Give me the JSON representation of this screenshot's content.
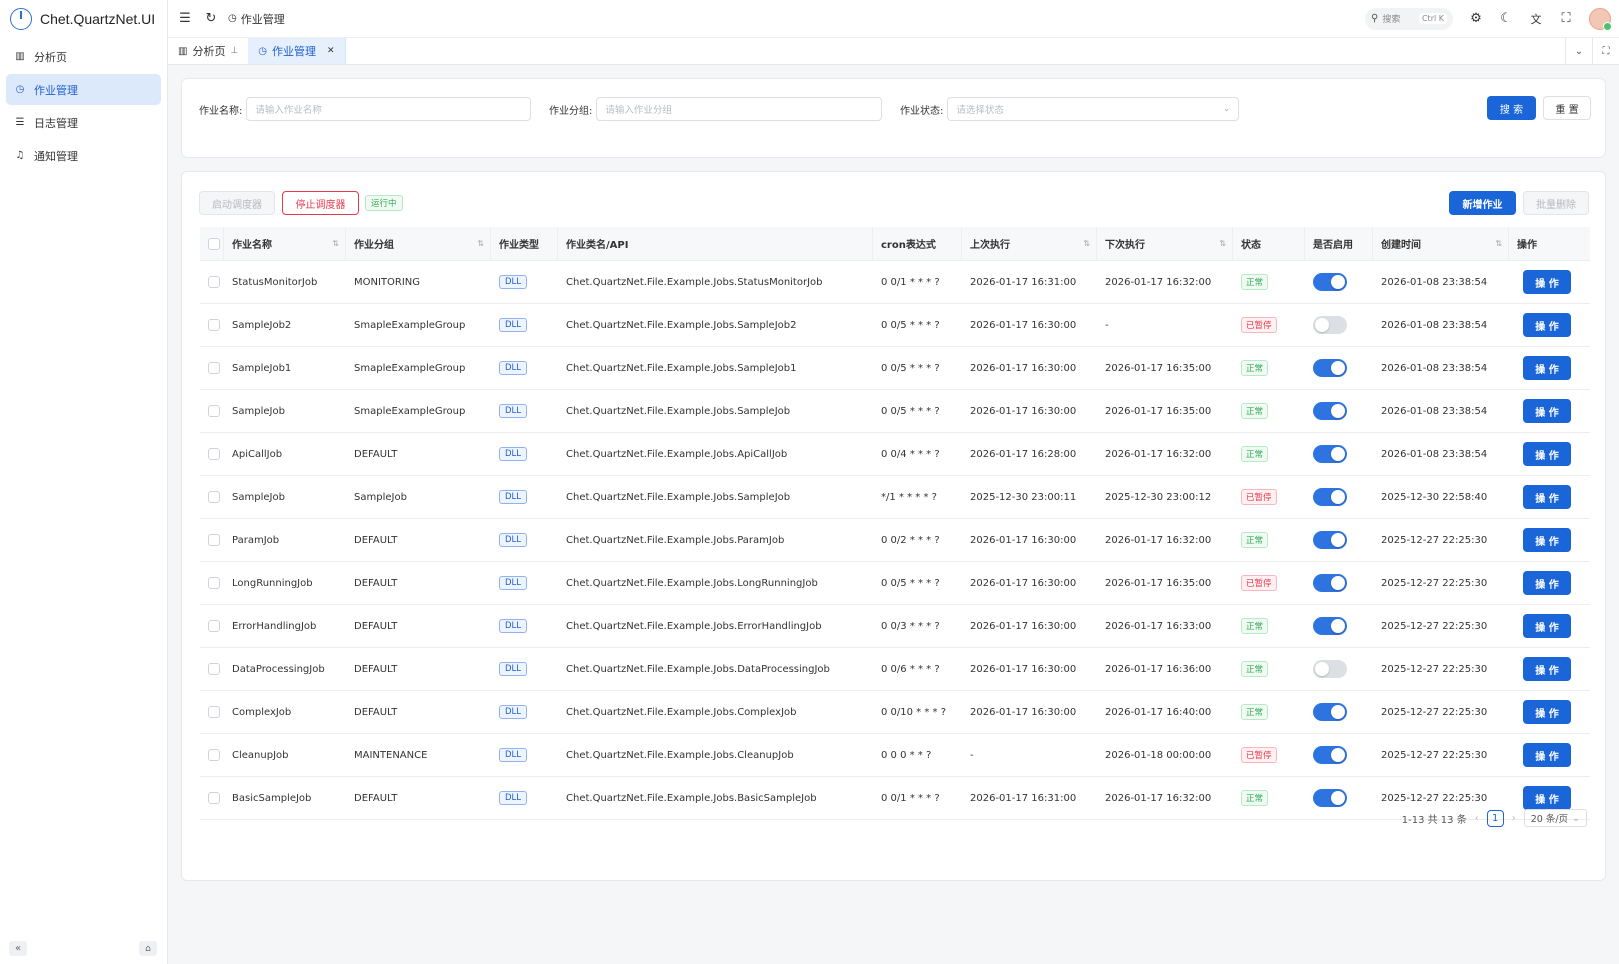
{
  "app": {
    "title": "Chet.QuartzNet.UI"
  },
  "sidebar": {
    "items": [
      {
        "label": "分析页",
        "icon": "chart-icon",
        "active": false
      },
      {
        "label": "作业管理",
        "icon": "clock-icon",
        "active": true
      },
      {
        "label": "日志管理",
        "icon": "list-icon",
        "active": false
      },
      {
        "label": "通知管理",
        "icon": "bell-icon",
        "active": false
      }
    ],
    "collapse_glyph": "«",
    "pin_glyph": "⌂"
  },
  "header": {
    "breadcrumb": "作业管理",
    "search_placeholder": "搜索",
    "search_shortcut": "Ctrl K"
  },
  "tabs": [
    {
      "label": "分析页",
      "active": false
    },
    {
      "label": "作业管理",
      "active": true
    }
  ],
  "filters": {
    "job_name": {
      "label": "作业名称:",
      "placeholder": "请输入作业名称"
    },
    "job_group": {
      "label": "作业分组:",
      "placeholder": "请输入作业分组"
    },
    "job_status": {
      "label": "作业状态:",
      "placeholder": "请选择状态"
    },
    "search_button": "搜 索",
    "reset_button": "重 置"
  },
  "toolbar": {
    "start_scheduler": "启动调度器",
    "stop_scheduler": "停止调度器",
    "scheduler_status": "运行中",
    "add_job": "新增作业",
    "batch_delete": "批量删除"
  },
  "table": {
    "columns": [
      "作业名称",
      "作业分组",
      "作业类型",
      "作业类名/API",
      "cron表达式",
      "上次执行",
      "下次执行",
      "状态",
      "是否启用",
      "创建时间",
      "操作"
    ],
    "op_label": "操 作",
    "rows": [
      {
        "name": "StatusMonitorJob",
        "group": "MONITORING",
        "type": "DLL",
        "class": "Chet.QuartzNet.File.Example.Jobs.StatusMonitorJob",
        "cron": "0 0/1 * * * ?",
        "last": "2026-01-17 16:31:00",
        "next": "2026-01-17 16:32:00",
        "status": "正常",
        "enabled": true,
        "created": "2026-01-08 23:38:54"
      },
      {
        "name": "SampleJob2",
        "group": "SmapleExampleGroup",
        "type": "DLL",
        "class": "Chet.QuartzNet.File.Example.Jobs.SampleJob2",
        "cron": "0 0/5 * * * ?",
        "last": "2026-01-17 16:30:00",
        "next": "-",
        "status": "已暂停",
        "enabled": false,
        "created": "2026-01-08 23:38:54"
      },
      {
        "name": "SampleJob1",
        "group": "SmapleExampleGroup",
        "type": "DLL",
        "class": "Chet.QuartzNet.File.Example.Jobs.SampleJob1",
        "cron": "0 0/5 * * * ?",
        "last": "2026-01-17 16:30:00",
        "next": "2026-01-17 16:35:00",
        "status": "正常",
        "enabled": true,
        "created": "2026-01-08 23:38:54"
      },
      {
        "name": "SampleJob",
        "group": "SmapleExampleGroup",
        "type": "DLL",
        "class": "Chet.QuartzNet.File.Example.Jobs.SampleJob",
        "cron": "0 0/5 * * * ?",
        "last": "2026-01-17 16:30:00",
        "next": "2026-01-17 16:35:00",
        "status": "正常",
        "enabled": true,
        "created": "2026-01-08 23:38:54"
      },
      {
        "name": "ApiCallJob",
        "group": "DEFAULT",
        "type": "DLL",
        "class": "Chet.QuartzNet.File.Example.Jobs.ApiCallJob",
        "cron": "0 0/4 * * * ?",
        "last": "2026-01-17 16:28:00",
        "next": "2026-01-17 16:32:00",
        "status": "正常",
        "enabled": true,
        "created": "2026-01-08 23:38:54"
      },
      {
        "name": "SampleJob",
        "group": "SampleJob",
        "type": "DLL",
        "class": "Chet.QuartzNet.File.Example.Jobs.SampleJob",
        "cron": "*/1 * * * * ?",
        "last": "2025-12-30 23:00:11",
        "next": "2025-12-30 23:00:12",
        "status": "已暂停",
        "enabled": true,
        "created": "2025-12-30 22:58:40"
      },
      {
        "name": "ParamJob",
        "group": "DEFAULT",
        "type": "DLL",
        "class": "Chet.QuartzNet.File.Example.Jobs.ParamJob",
        "cron": "0 0/2 * * * ?",
        "last": "2026-01-17 16:30:00",
        "next": "2026-01-17 16:32:00",
        "status": "正常",
        "enabled": true,
        "created": "2025-12-27 22:25:30"
      },
      {
        "name": "LongRunningJob",
        "group": "DEFAULT",
        "type": "DLL",
        "class": "Chet.QuartzNet.File.Example.Jobs.LongRunningJob",
        "cron": "0 0/5 * * * ?",
        "last": "2026-01-17 16:30:00",
        "next": "2026-01-17 16:35:00",
        "status": "已暂停",
        "enabled": true,
        "created": "2025-12-27 22:25:30"
      },
      {
        "name": "ErrorHandlingJob",
        "group": "DEFAULT",
        "type": "DLL",
        "class": "Chet.QuartzNet.File.Example.Jobs.ErrorHandlingJob",
        "cron": "0 0/3 * * * ?",
        "last": "2026-01-17 16:30:00",
        "next": "2026-01-17 16:33:00",
        "status": "正常",
        "enabled": true,
        "created": "2025-12-27 22:25:30"
      },
      {
        "name": "DataProcessingJob",
        "group": "DEFAULT",
        "type": "DLL",
        "class": "Chet.QuartzNet.File.Example.Jobs.DataProcessingJob",
        "cron": "0 0/6 * * * ?",
        "last": "2026-01-17 16:30:00",
        "next": "2026-01-17 16:36:00",
        "status": "正常",
        "enabled": false,
        "created": "2025-12-27 22:25:30"
      },
      {
        "name": "ComplexJob",
        "group": "DEFAULT",
        "type": "DLL",
        "class": "Chet.QuartzNet.File.Example.Jobs.ComplexJob",
        "cron": "0 0/10 * * * ?",
        "last": "2026-01-17 16:30:00",
        "next": "2026-01-17 16:40:00",
        "status": "正常",
        "enabled": true,
        "created": "2025-12-27 22:25:30"
      },
      {
        "name": "CleanupJob",
        "group": "MAINTENANCE",
        "type": "DLL",
        "class": "Chet.QuartzNet.File.Example.Jobs.CleanupJob",
        "cron": "0 0 0 * * ?",
        "last": "-",
        "next": "2026-01-18 00:00:00",
        "status": "已暂停",
        "enabled": true,
        "created": "2025-12-27 22:25:30"
      },
      {
        "name": "BasicSampleJob",
        "group": "DEFAULT",
        "type": "DLL",
        "class": "Chet.QuartzNet.File.Example.Jobs.BasicSampleJob",
        "cron": "0 0/1 * * * ?",
        "last": "2026-01-17 16:31:00",
        "next": "2026-01-17 16:32:00",
        "status": "正常",
        "enabled": true,
        "created": "2025-12-27 22:25:30"
      }
    ]
  },
  "pagination": {
    "summary": "1-13 共 13 条",
    "current_page": "1",
    "page_size": "20 条/页"
  },
  "colors": {
    "primary": "#1a66d9",
    "danger": "#e8384f",
    "success": "#33a957"
  }
}
